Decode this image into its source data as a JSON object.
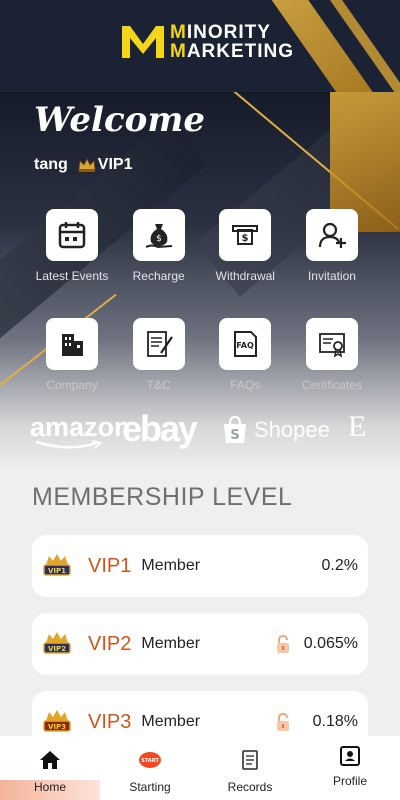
{
  "brand": {
    "line1_a": "M",
    "line1_b": "INORITY",
    "line2_a": "M",
    "line2_b": "ARKETING"
  },
  "welcome": "Welcome",
  "user": {
    "name": "tang",
    "vip": "VIP1"
  },
  "menu": [
    {
      "label": "Latest Events",
      "icon": "calendar-icon"
    },
    {
      "label": "Recharge",
      "icon": "money-bag-icon"
    },
    {
      "label": "Withdrawal",
      "icon": "cash-withdraw-icon"
    },
    {
      "label": "Invitation",
      "icon": "add-user-icon"
    },
    {
      "label": "Company",
      "icon": "building-icon"
    },
    {
      "label": "T&C",
      "icon": "document-sign-icon"
    },
    {
      "label": "FAQs",
      "icon": "faq-icon"
    },
    {
      "label": "Certificates",
      "icon": "certificate-icon"
    }
  ],
  "partners": [
    "amazon",
    "ebay",
    "Shopee",
    "E"
  ],
  "membership": {
    "title": "MEMBERSHIP LEVEL",
    "levels": [
      {
        "level": "VIP1",
        "member": "Member",
        "rate": "0.2%",
        "locked": false
      },
      {
        "level": "VIP2",
        "member": "Member",
        "rate": "0.065%",
        "locked": true
      },
      {
        "level": "VIP3",
        "member": "Member",
        "rate": "0.18%",
        "locked": true
      }
    ]
  },
  "nav": [
    {
      "label": "Home",
      "icon": "home-icon",
      "active": true
    },
    {
      "label": "Starting",
      "icon": "start-icon"
    },
    {
      "label": "Records",
      "icon": "records-icon"
    },
    {
      "label": "Profile",
      "icon": "profile-icon"
    }
  ],
  "colors": {
    "accent": "#d2541b",
    "gold": "#e0b040",
    "header": "#1b2233"
  }
}
